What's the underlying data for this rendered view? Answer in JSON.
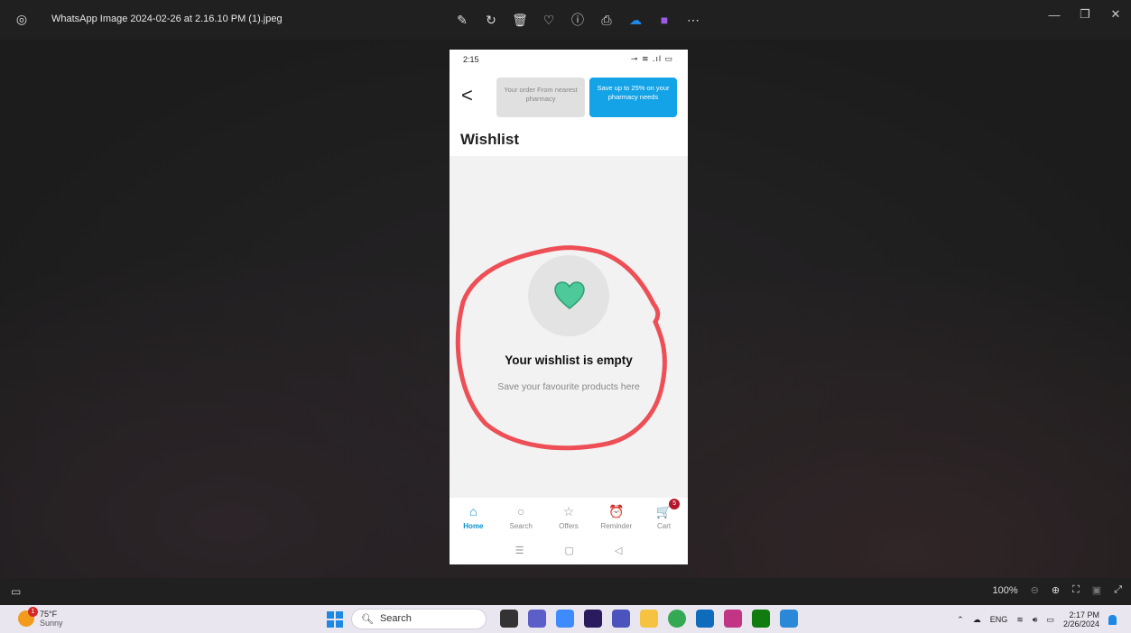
{
  "window": {
    "file_name": "WhatsApp Image 2024-02-26 at 2.16.10 PM (1).jpeg",
    "toolbar_icons": [
      "edit-icon",
      "rotate-icon",
      "delete-icon",
      "favorite-icon",
      "info-icon",
      "print-icon",
      "onedrive-icon",
      "clipchamp-icon",
      "more-icon"
    ]
  },
  "phone": {
    "status_time": "2:15",
    "status_icons": "⊸ ≋ .ıl ▭",
    "back_glyph": "<",
    "promo_left": "Your order From nearest pharmacy",
    "promo_right": "Save up to 25% on your pharmacy needs",
    "page_title": "Wishlist",
    "empty_title": "Your wishlist is empty",
    "empty_subtitle": "Save your favourite products here",
    "nav": [
      {
        "label": "Home",
        "icon": "⌂"
      },
      {
        "label": "Search",
        "icon": "○"
      },
      {
        "label": "Offers",
        "icon": "☆"
      },
      {
        "label": "Reminder",
        "icon": "⏰"
      },
      {
        "label": "Cart",
        "icon": "🛒"
      }
    ],
    "cart_count": "5",
    "accent_color": "#13a3e6",
    "heart_color": "#4dc99a",
    "scribble_color": "#ee4f56"
  },
  "viewer": {
    "zoom": "100%"
  },
  "taskbar": {
    "temperature": "75°F",
    "condition": "Sunny",
    "weather_badge": "1",
    "search_placeholder": "Search",
    "language": "ENG",
    "time": "2:17 PM",
    "date": "2/26/2024"
  }
}
